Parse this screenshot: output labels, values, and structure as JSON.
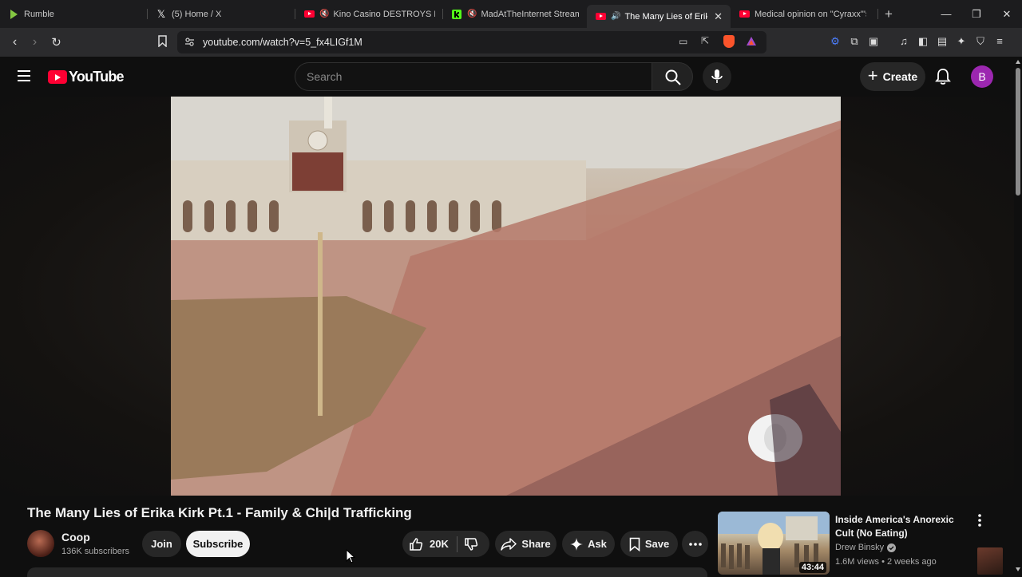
{
  "browser": {
    "tabs": [
      {
        "label": "Rumble",
        "icon": "rumble-icon",
        "active": false
      },
      {
        "label": "(5) Home / X",
        "icon": "x-icon",
        "active": false
      },
      {
        "label": "Kino Casino DESTROYS DSP",
        "icon": "youtube-icon",
        "active": false
      },
      {
        "label": "MadAtTheInternet Stream -",
        "icon": "kick-icon",
        "active": false
      },
      {
        "label": "The Many Lies of Erika K",
        "icon": "youtube-icon",
        "active": true
      },
      {
        "label": "Medical opinion on \"Cyraxx\"'s m",
        "icon": "youtube-icon",
        "active": false
      }
    ],
    "url": "youtube.com/watch?v=5_fx4LIGf1M"
  },
  "youtube": {
    "logo_text": "YouTube",
    "search_placeholder": "Search",
    "create_label": "Create",
    "avatar_letter": "B"
  },
  "video": {
    "title": "The Many Lies of Erika Kirk Pt.1 - Family & Chi|d Trafficking",
    "channel": {
      "name": "Coop",
      "subscribers": "136K subscribers",
      "join_label": "Join",
      "subscribe_label": "Subscribe"
    },
    "actions": {
      "likes": "20K",
      "share_label": "Share",
      "ask_label": "Ask",
      "save_label": "Save"
    }
  },
  "recommendation": {
    "title": "Inside America's Anorexic Cult (No Eating)",
    "channel": "Drew Binsky",
    "meta": "1.6M views • 2 weeks ago",
    "duration": "43:44"
  },
  "colors": {
    "yt_red": "#ff0033",
    "avatar_purple": "#9c27b0",
    "background": "#0f0f0f"
  }
}
